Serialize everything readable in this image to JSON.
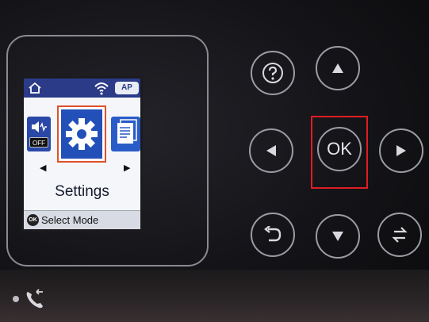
{
  "lcd": {
    "status_ap": "AP",
    "tile_left_off": "OFF",
    "selected_mode": "Settings",
    "footer_ok": "OK",
    "footer_text": "Select Mode"
  },
  "buttons": {
    "ok_label": "OK"
  },
  "icons": [
    "home-icon",
    "wifi-icon",
    "ap-icon",
    "volume-icon",
    "gear-icon",
    "documents-icon",
    "help-icon",
    "up-arrow-icon",
    "left-arrow-icon",
    "right-arrow-icon",
    "back-icon",
    "down-arrow-icon",
    "switch-icon",
    "phone-icon"
  ],
  "colors": {
    "lcd_header": "#2b3b88",
    "selection_border": "#e0502a",
    "highlight_box": "#e01c24",
    "button_ring": "#9c9ca4"
  }
}
